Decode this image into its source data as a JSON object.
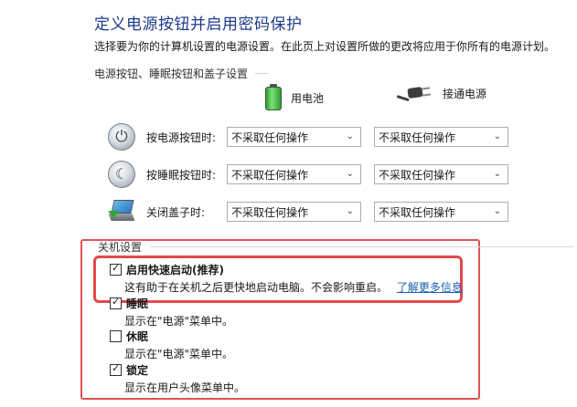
{
  "page": {
    "title": "定义电源按钮并启用密码保护",
    "subtitle": "选择要为你的计算机设置的电源设置。在此页上对设置所做的更改将应用于你所有的电源计划。"
  },
  "power_section": {
    "header": "电源按钮、睡眠按钮和盖子设置",
    "columns": {
      "battery": "用电池",
      "plugged_in": "接通电源"
    },
    "rows": [
      {
        "label": "按电源按钮时:",
        "battery_value": "不采取任何操作",
        "plugged_value": "不采取任何操作",
        "icon": "power-button-icon"
      },
      {
        "label": "按睡眠按钮时:",
        "battery_value": "不采取任何操作",
        "plugged_value": "不采取任何操作",
        "icon": "sleep-button-icon"
      },
      {
        "label": "关闭盖子时:",
        "battery_value": "不采取任何操作",
        "plugged_value": "不采取任何操作",
        "icon": "laptop-lid-icon"
      }
    ]
  },
  "shutdown_section": {
    "header": "关机设置",
    "options": [
      {
        "title": "启用快速启动(推荐)",
        "checked": true,
        "desc": "这有助于在关机之后更快地启动电脑。不会影响重启。",
        "link": "了解更多信息"
      },
      {
        "title": "睡眠",
        "checked": true,
        "desc": "显示在\"电源\"菜单中。"
      },
      {
        "title": "休眠",
        "checked": false,
        "desc": "显示在\"电源\"菜单中。"
      },
      {
        "title": "锁定",
        "checked": true,
        "desc": "显示在用户头像菜单中。"
      }
    ]
  },
  "colors": {
    "title": "#1e3a8a",
    "link": "#1a5fb4",
    "highlight_border": "#e34a4a"
  }
}
